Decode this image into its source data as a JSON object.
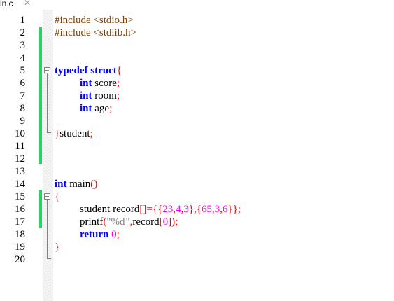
{
  "tab": {
    "name": "in.c",
    "close": "✕"
  },
  "line_numbers": [
    "1",
    "2",
    "3",
    "4",
    "5",
    "6",
    "7",
    "8",
    "9",
    "10",
    "11",
    "12",
    "13",
    "14",
    "15",
    "16",
    "17",
    "18",
    "19",
    "20"
  ],
  "code": {
    "l1": {
      "pp": "#include",
      "inc": " <stdio.h>"
    },
    "l2": {
      "pp": "#include",
      "inc": " <stdlib.h>"
    },
    "l5": {
      "kw1": "typedef",
      "kw2": "struct",
      "op": "{"
    },
    "l6": {
      "kw": "int",
      "id": " score",
      "op": ";"
    },
    "l7": {
      "kw": "int",
      "id": " room",
      "op": ";"
    },
    "l8": {
      "kw": "int",
      "id": " age",
      "op": ";"
    },
    "l10": {
      "op1": "}",
      "id": "student",
      "op2": ";"
    },
    "l14": {
      "kw": "int",
      "id": " main",
      "op": "()"
    },
    "l15": {
      "op": "{"
    },
    "l16": {
      "id1": "student record",
      "op1": "[]={{",
      "n1": "23",
      "c1": ",",
      "n2": "4",
      "c2": ",",
      "n3": "3",
      "op2": "},{",
      "n4": "65",
      "c3": ",",
      "n5": "3",
      "c4": ",",
      "n6": "6",
      "op3": "}};"
    },
    "l17": {
      "id1": "printf",
      "op1": "(",
      "str1": "\"%d",
      "str2": "\"",
      "op2": ",",
      "id2": "record",
      "op3": "[",
      "n1": "0",
      "op4": "]);"
    },
    "l18": {
      "kw": "return",
      "n": " 0",
      "op": ";"
    },
    "l19": {
      "op": "}"
    }
  },
  "colors": {
    "keyword": "#0000ff",
    "preprocessor": "#804000",
    "operator": "#ff0000",
    "number": "#ff00ff",
    "change_bar": "#22d85a"
  }
}
